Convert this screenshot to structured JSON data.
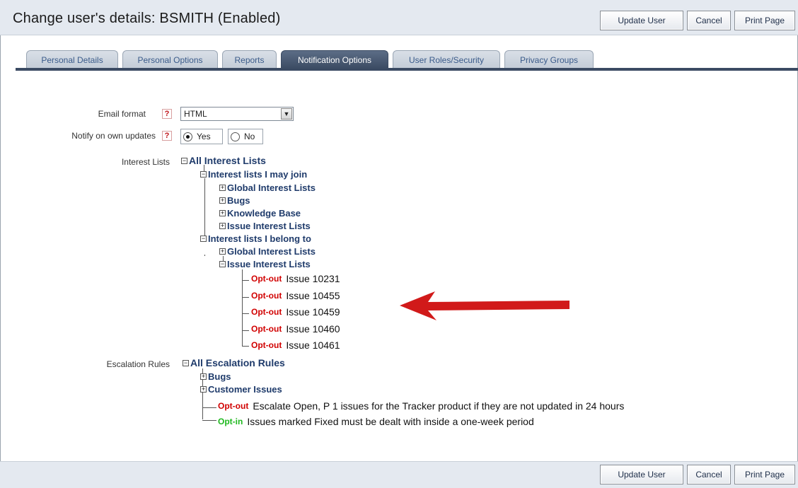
{
  "header": {
    "title": "Change user's details: BSMITH (Enabled)",
    "buttons": {
      "update": "Update User",
      "cancel": "Cancel",
      "print": "Print Page"
    }
  },
  "tabs": [
    {
      "label": "Personal Details",
      "active": false
    },
    {
      "label": "Personal Options",
      "active": false
    },
    {
      "label": "Reports",
      "active": false
    },
    {
      "label": "Notification Options",
      "active": true
    },
    {
      "label": "User Roles/Security",
      "active": false
    },
    {
      "label": "Privacy Groups",
      "active": false
    }
  ],
  "form": {
    "email_format": {
      "label": "Email format",
      "value": "HTML",
      "help": "?"
    },
    "notify_own": {
      "label": "Notify on own updates",
      "help": "?",
      "yes": "Yes",
      "no": "No",
      "selected": "Yes"
    },
    "interest_lists": {
      "label": "Interest Lists",
      "root": "All Interest Lists",
      "may_join": {
        "label": "Interest lists I may join",
        "children": [
          "Global Interest Lists",
          "Bugs",
          "Knowledge Base",
          "Issue Interest Lists"
        ]
      },
      "belong_to": {
        "label": "Interest lists I belong to",
        "global": "Global Interest Lists",
        "issue": "Issue Interest Lists",
        "issues": [
          {
            "action": "Opt-out",
            "text": "Issue 10231"
          },
          {
            "action": "Opt-out",
            "text": "Issue 10455"
          },
          {
            "action": "Opt-out",
            "text": "Issue 10459"
          },
          {
            "action": "Opt-out",
            "text": "Issue 10460"
          },
          {
            "action": "Opt-out",
            "text": "Issue 10461"
          }
        ]
      }
    },
    "escalation_rules": {
      "label": "Escalation Rules",
      "root": "All Escalation Rules",
      "children": [
        "Bugs",
        "Customer Issues"
      ],
      "rules": [
        {
          "action": "Opt-out",
          "text": "Escalate Open, P 1 issues for the Tracker product if they are not updated in 24 hours"
        },
        {
          "action": "Opt-in",
          "text": "Issues marked Fixed must be dealt with inside a one-week period"
        }
      ]
    }
  },
  "footer": {
    "buttons": {
      "update": "Update User",
      "cancel": "Cancel",
      "print": "Print Page"
    }
  },
  "colors": {
    "header_bg": "#e4e9f0",
    "active_tab": "#3b4b63",
    "tree_text": "#1f3b6b",
    "opt_out": "#d10000",
    "opt_in": "#1fb81f",
    "arrow": "#d11a1a"
  }
}
